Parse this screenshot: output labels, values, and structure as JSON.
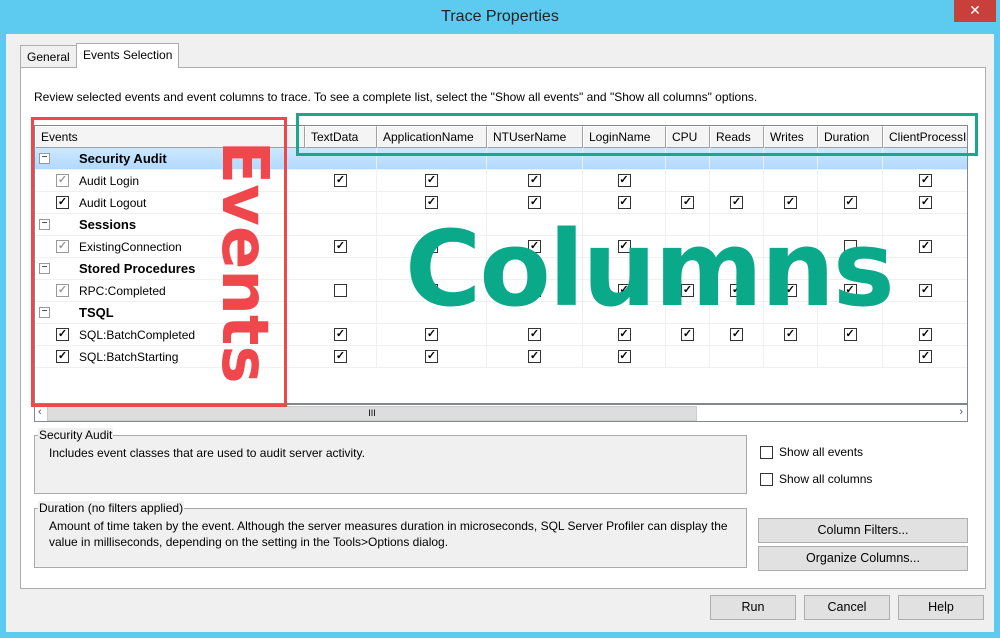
{
  "window": {
    "title": "Trace Properties",
    "close_icon": "close-icon"
  },
  "tabs": [
    {
      "label": "General"
    },
    {
      "label": "Events Selection",
      "active": true
    }
  ],
  "intro": "Review selected events and event columns to trace. To see a complete list, select the \"Show all events\" and \"Show all columns\" options.",
  "grid": {
    "columns": [
      "Events",
      "TextData",
      "ApplicationName",
      "NTUserName",
      "LoginName",
      "CPU",
      "Reads",
      "Writes",
      "Duration",
      "ClientProcessI"
    ],
    "rows": [
      {
        "type": "category",
        "label": "Security Audit",
        "selected": true
      },
      {
        "type": "event",
        "label": "Audit Login",
        "state": "gray",
        "cells": [
          "c",
          "c",
          "c",
          "c",
          "",
          "",
          "",
          "",
          "c"
        ]
      },
      {
        "type": "event",
        "label": "Audit Logout",
        "state": "checked",
        "cells": [
          "",
          "c",
          "c",
          "c",
          "c",
          "c",
          "c",
          "c",
          "c"
        ]
      },
      {
        "type": "category",
        "label": "Sessions"
      },
      {
        "type": "event",
        "label": "ExistingConnection",
        "state": "gray",
        "cells": [
          "c",
          "c",
          "c",
          "c",
          "",
          "",
          "",
          "u",
          "c"
        ]
      },
      {
        "type": "category",
        "label": "Stored Procedures"
      },
      {
        "type": "event",
        "label": "RPC:Completed",
        "state": "gray",
        "cells": [
          "u",
          "c",
          "c",
          "c",
          "c",
          "c",
          "c",
          "c",
          "c"
        ]
      },
      {
        "type": "category",
        "label": "TSQL"
      },
      {
        "type": "event",
        "label": "SQL:BatchCompleted",
        "state": "checked",
        "cells": [
          "c",
          "c",
          "c",
          "c",
          "c",
          "c",
          "c",
          "c",
          "c"
        ]
      },
      {
        "type": "event",
        "label": "SQL:BatchStarting",
        "state": "checked",
        "cells": [
          "c",
          "c",
          "c",
          "c",
          "",
          "",
          "",
          "",
          "c"
        ]
      }
    ],
    "scroll_thumb": "III"
  },
  "event_desc": {
    "title": "Security Audit",
    "text": "Includes event classes that are used to audit server activity."
  },
  "column_desc": {
    "title": "Duration (no filters applied)",
    "text": "Amount of time taken by the event. Although the server measures duration in microseconds, SQL Server Profiler can display the value in milliseconds, depending on the setting in the Tools>Options dialog."
  },
  "options": {
    "show_all_events": "Show all events",
    "show_all_columns": "Show all columns"
  },
  "buttons": {
    "column_filters": "Column Filters...",
    "organize_columns": "Organize Columns...",
    "run": "Run",
    "cancel": "Cancel",
    "help": "Help"
  },
  "annotations": {
    "events": "Events",
    "columns": "Columns",
    "events_color": "#f0474c",
    "columns_color": "#0aa98a"
  }
}
